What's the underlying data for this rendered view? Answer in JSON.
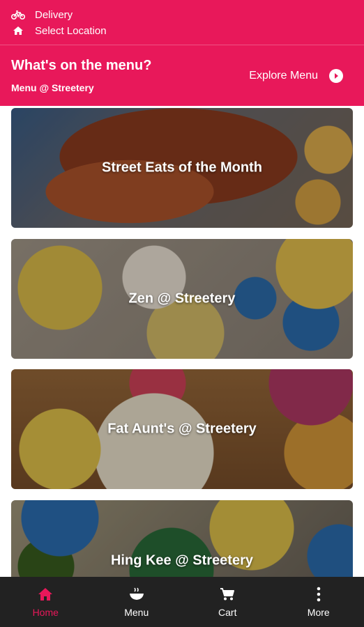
{
  "header": {
    "delivery_label": "Delivery",
    "location_label": "Select Location",
    "title": "What's on the menu?",
    "subtitle": "Menu @ Streetery",
    "explore_label": "Explore Menu",
    "bg_color": "#e8185a"
  },
  "icons": {
    "delivery": "bicycle-icon",
    "location": "home-icon",
    "explore": "chevron-right-circle-icon"
  },
  "cards": [
    {
      "label": "Street Eats of the Month"
    },
    {
      "label": "Zen @ Streetery"
    },
    {
      "label": "Fat Aunt's @ Streetery"
    },
    {
      "label": "Hing Kee @ Streetery"
    }
  ],
  "tabs": [
    {
      "label": "Home",
      "icon": "home-icon",
      "active": true
    },
    {
      "label": "Menu",
      "icon": "food-bowl-icon",
      "active": false
    },
    {
      "label": "Cart",
      "icon": "cart-icon",
      "active": false
    },
    {
      "label": "More",
      "icon": "more-vertical-icon",
      "active": false
    }
  ],
  "colors": {
    "accent": "#e8185a",
    "tabbar": "#222222"
  }
}
